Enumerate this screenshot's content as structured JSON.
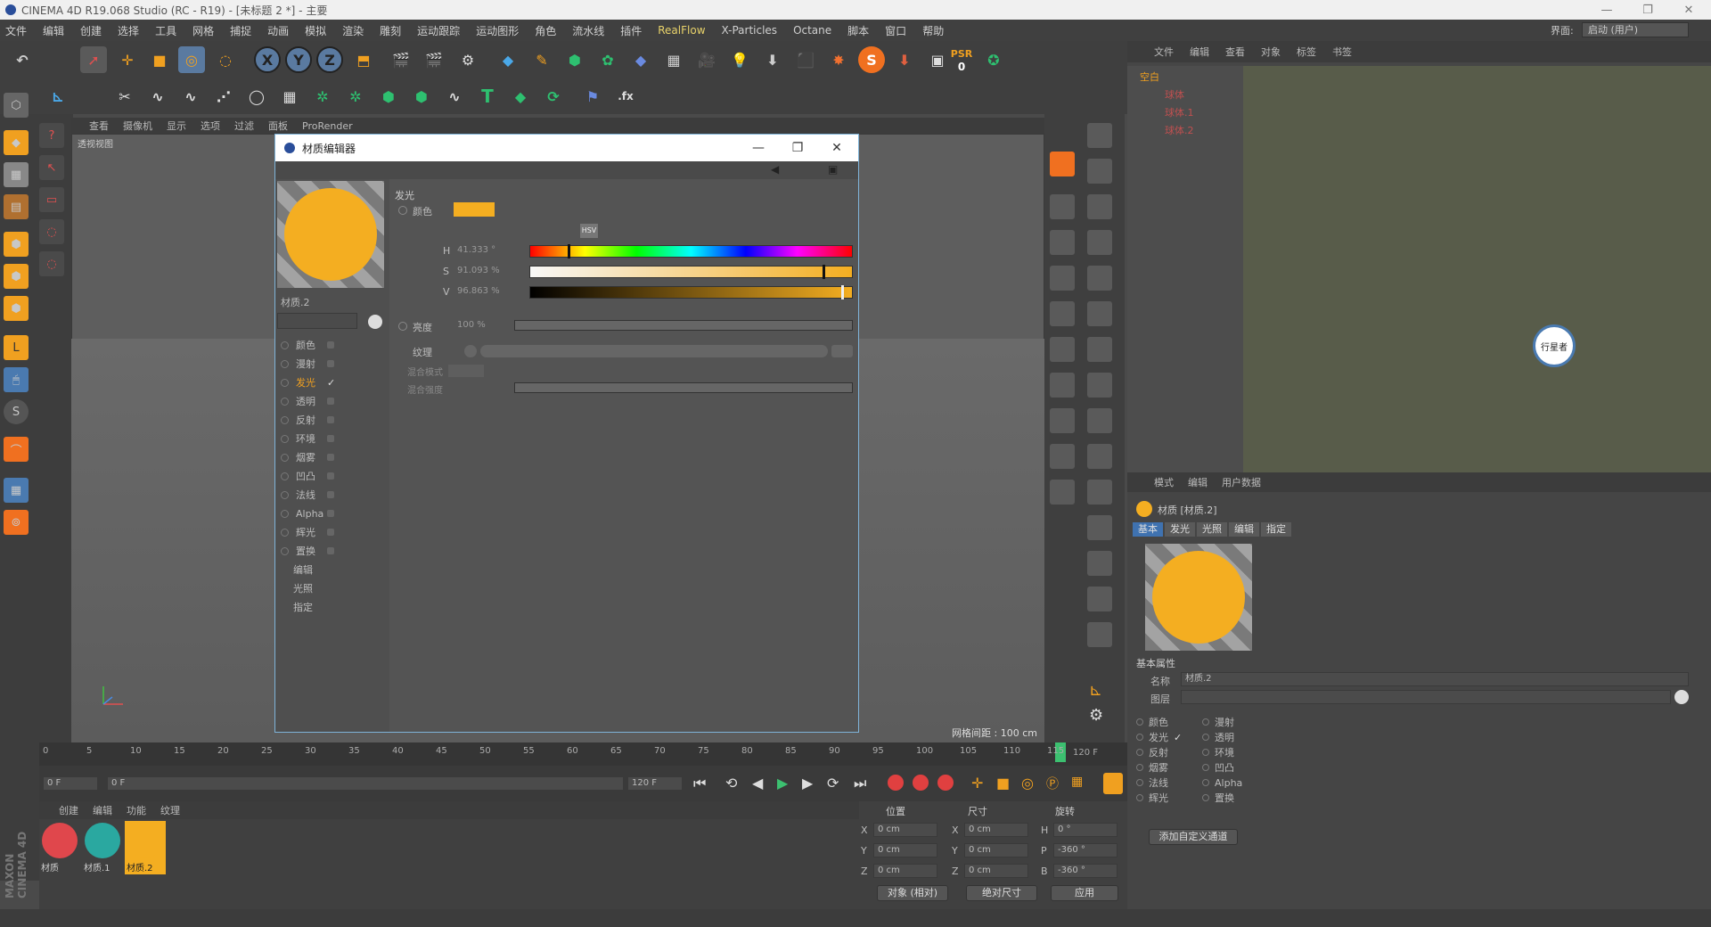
{
  "window": {
    "title": "CINEMA 4D R19.068 Studio (RC - R19) - [未标题 2 *] - 主要",
    "controls": [
      "—",
      "❐",
      "✕"
    ]
  },
  "menubar": {
    "items": [
      "文件",
      "编辑",
      "创建",
      "选择",
      "工具",
      "网格",
      "捕捉",
      "动画",
      "模拟",
      "渲染",
      "雕刻",
      "运动跟踪",
      "运动图形",
      "角色",
      "流水线",
      "插件",
      "RealFlow",
      "X-Particles",
      "Octane",
      "脚本",
      "窗口",
      "帮助"
    ],
    "layout_label": "界面:",
    "layout_value": "启动 (用户)"
  },
  "toolbar": {
    "axis_x": "X",
    "axis_y": "Y",
    "axis_z": "Z",
    "psr_label": "PSR",
    "psr_value": "0",
    "s_label": "S",
    "text_tool": "T",
    "fx_label": ".fx"
  },
  "viewport": {
    "menu": [
      "查看",
      "摄像机",
      "显示",
      "选项",
      "过滤",
      "面板",
      "ProRender"
    ],
    "name": "透视视图",
    "grid_info": "网格间距 : 100 cm"
  },
  "object_manager": {
    "menu": [
      "文件",
      "编辑",
      "查看",
      "对象",
      "标签",
      "书签"
    ],
    "root": "空白",
    "children": [
      "球体",
      "球体.1",
      "球体.2"
    ],
    "tag_colors": [
      "#e0474c",
      "#2aa8a0",
      "#f4ae21"
    ]
  },
  "material_editor": {
    "title": "材质编辑器",
    "material_name": "材质.2",
    "preview_color": "#f4ae21",
    "channels": [
      {
        "label": "颜色",
        "checked": false
      },
      {
        "label": "漫射",
        "checked": false
      },
      {
        "label": "发光",
        "checked": true,
        "active": true
      },
      {
        "label": "透明",
        "checked": false
      },
      {
        "label": "反射",
        "checked": false
      },
      {
        "label": "环境",
        "checked": false
      },
      {
        "label": "烟雾",
        "checked": false
      },
      {
        "label": "凹凸",
        "checked": false
      },
      {
        "label": "法线",
        "checked": false
      },
      {
        "label": "Alpha",
        "checked": false
      },
      {
        "label": "辉光",
        "checked": false
      },
      {
        "label": "置换",
        "checked": false
      },
      {
        "label": "编辑",
        "checked": null
      },
      {
        "label": "光照",
        "checked": null
      },
      {
        "label": "指定",
        "checked": null
      }
    ],
    "section": "发光",
    "color_label": "颜色",
    "color_swatch": "#f4ae21",
    "mode_label": "HSV",
    "h_label": "H",
    "h_value": "41.333 °",
    "h_fraction": 0.115,
    "s_label": "S",
    "s_value": "91.093 %",
    "s_fraction": 0.911,
    "v_label": "V",
    "v_value": "96.863 %",
    "v_fraction": 0.969,
    "brightness_label": "亮度",
    "brightness_value": "100 %",
    "texture_label": "纹理",
    "blend_mode_label": "混合模式",
    "blend_strength_label": "混合强度"
  },
  "timeline": {
    "ticks": [
      "0",
      "5",
      "10",
      "15",
      "20",
      "25",
      "30",
      "35",
      "40",
      "45",
      "50",
      "55",
      "60",
      "65",
      "70",
      "75",
      "80",
      "85",
      "90",
      "95",
      "100",
      "105",
      "110",
      "115"
    ],
    "end_frame": "120 F",
    "current_frame": "0 F",
    "start_field": "0 F",
    "end_field": "120 F",
    "range_end": "120 F"
  },
  "material_manager": {
    "menu": [
      "创建",
      "编辑",
      "功能",
      "纹理"
    ],
    "materials": [
      {
        "name": "材质",
        "color": "#e0474c"
      },
      {
        "name": "材质.1",
        "color": "#2aa8a0"
      },
      {
        "name": "材质.2",
        "color": "#f4ae21",
        "selected": true
      }
    ]
  },
  "coordinates": {
    "headers": [
      "位置",
      "尺寸",
      "旋转"
    ],
    "rows": [
      {
        "axis": "X",
        "pos": "0 cm",
        "size_axis": "X",
        "size": "0 cm",
        "rot_axis": "H",
        "rot": "0 °"
      },
      {
        "axis": "Y",
        "pos": "0 cm",
        "size_axis": "Y",
        "size": "0 cm",
        "rot_axis": "P",
        "rot": "-360 °"
      },
      {
        "axis": "Z",
        "pos": "0 cm",
        "size_axis": "Z",
        "size": "0 cm",
        "rot_axis": "B",
        "rot": "-360 °"
      }
    ],
    "mode_select": "对象 (相对)",
    "size_select": "绝对尺寸",
    "apply_button": "应用"
  },
  "attributes": {
    "menu": [
      "模式",
      "编辑",
      "用户数据"
    ],
    "header": "材质 [材质.2]",
    "tabs": [
      "基本",
      "发光",
      "光照",
      "编辑",
      "指定"
    ],
    "section": "基本属性",
    "name_label": "名称",
    "name_value": "材质.2",
    "layer_label": "图层",
    "channels_left": [
      {
        "label": "颜色",
        "checked": false
      },
      {
        "label": "发光",
        "checked": true
      },
      {
        "label": "反射",
        "checked": false
      },
      {
        "label": "烟雾",
        "checked": false
      },
      {
        "label": "法线",
        "checked": false
      },
      {
        "label": "辉光",
        "checked": false
      }
    ],
    "channels_right": [
      {
        "label": "漫射",
        "checked": false
      },
      {
        "label": "透明",
        "checked": false
      },
      {
        "label": "环境",
        "checked": false
      },
      {
        "label": "凹凸",
        "checked": false
      },
      {
        "label": "Alpha",
        "checked": false
      },
      {
        "label": "置换",
        "checked": false
      }
    ],
    "custom_channel_button": "添加自定义通道"
  },
  "watermark": {
    "text": "行星者"
  },
  "branding": {
    "vertical": "MAXON CINEMA 4D"
  }
}
